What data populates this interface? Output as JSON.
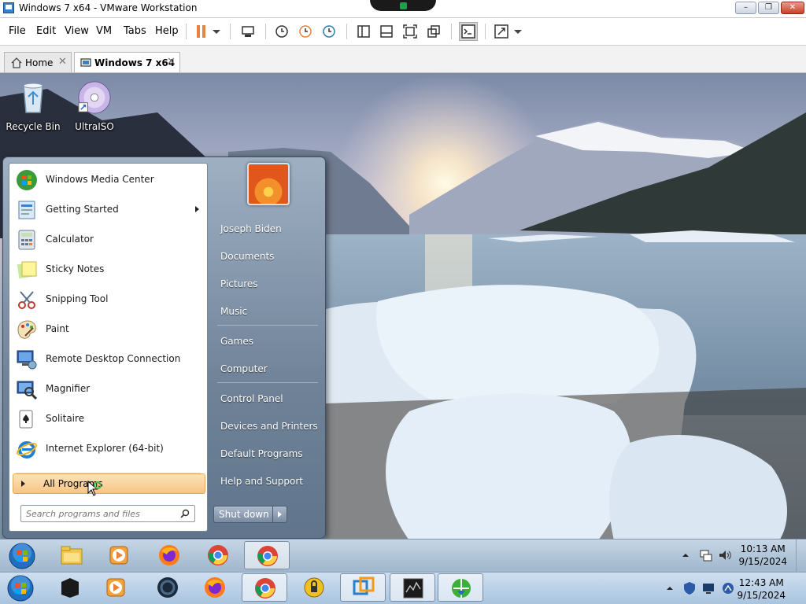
{
  "vmware": {
    "window_title": "Windows 7 x64 - VMware Workstation",
    "menu": [
      "File",
      "Edit",
      "View",
      "VM",
      "Tabs",
      "Help"
    ],
    "tabs": [
      {
        "label": "Home",
        "active": false
      },
      {
        "label": "Windows 7 x64",
        "active": true
      }
    ],
    "accent_colors": {
      "pause": "#e8823c",
      "titlebar_close": "#c9402a"
    }
  },
  "desktop_icons": [
    {
      "label": "Recycle Bin",
      "icon": "recycle-bin-icon"
    },
    {
      "label": "UltraISO",
      "icon": "ultraiso-disc-icon"
    }
  ],
  "start_menu": {
    "programs": [
      {
        "label": "Windows Media Center",
        "icon": "windows-media-center-icon"
      },
      {
        "label": "Getting Started",
        "icon": "getting-started-icon",
        "submenu": true
      },
      {
        "label": "Calculator",
        "icon": "calculator-icon"
      },
      {
        "label": "Sticky Notes",
        "icon": "sticky-notes-icon"
      },
      {
        "label": "Snipping Tool",
        "icon": "snipping-tool-icon"
      },
      {
        "label": "Paint",
        "icon": "paint-icon"
      },
      {
        "label": "Remote Desktop Connection",
        "icon": "remote-desktop-icon"
      },
      {
        "label": "Magnifier",
        "icon": "magnifier-icon"
      },
      {
        "label": "Solitaire",
        "icon": "solitaire-icon"
      },
      {
        "label": "Internet Explorer (64-bit)",
        "icon": "internet-explorer-icon"
      }
    ],
    "all_programs": "All Programs",
    "search_placeholder": "Search programs and files",
    "user_name": "Joseph Biden",
    "right_items": [
      "Documents",
      "Pictures",
      "Music",
      "Games",
      "Computer",
      "Control Panel",
      "Devices and Printers",
      "Default Programs",
      "Help and Support"
    ],
    "shutdown_label": "Shut down"
  },
  "guest_taskbar": {
    "pinned": [
      "start-orb-icon",
      "explorer-icon",
      "media-player-icon",
      "firefox-icon",
      "chrome-icon",
      "chrome-icon"
    ],
    "time": "10:13 AM",
    "date": "9/15/2024"
  },
  "host_taskbar": {
    "pinned": [
      "start-orb-icon",
      "terminal-icon",
      "media-player-icon",
      "obs-icon",
      "firefox-icon",
      "chrome-icon",
      "vpn-icon",
      "vmware-icon",
      "task-manager-icon",
      "network-icon"
    ],
    "time": "12:43 AM",
    "date": "9/15/2024"
  }
}
